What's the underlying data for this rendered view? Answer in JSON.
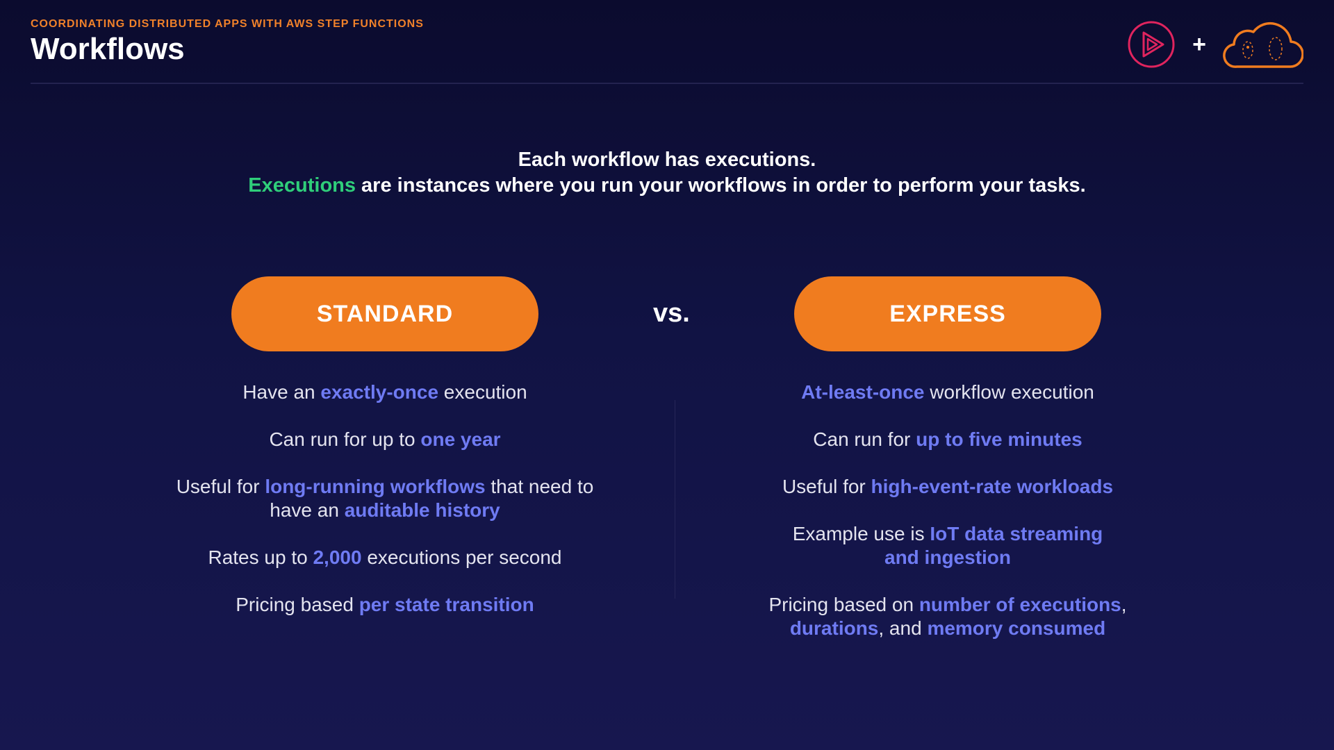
{
  "header": {
    "course": "COORDINATING DISTRIBUTED APPS WITH AWS STEP FUNCTIONS",
    "title": "Workflows",
    "plus": "+"
  },
  "intro": {
    "line1": "Each workflow has executions.",
    "line2_highlight": "Executions",
    "line2_rest": " are instances where you run your workflows in order to perform your tasks."
  },
  "standard": {
    "label": "STANDARD",
    "items": [
      {
        "a": "Have an ",
        "b": "exactly-once",
        "c": " execution"
      },
      {
        "a": "Can run for up to ",
        "b": "one year"
      },
      {
        "a": "Useful for ",
        "b": "long-running workflows",
        "c": " that need to have an ",
        "d": "auditable history"
      },
      {
        "a": "Rates up to ",
        "b": "2,000",
        "c": " executions per second"
      },
      {
        "a": "Pricing based ",
        "b": "per state transition"
      }
    ]
  },
  "vs": "vs.",
  "express": {
    "label": "EXPRESS",
    "items": [
      {
        "b": "At-least-once",
        "c": " workflow execution"
      },
      {
        "a": "Can run for ",
        "b": "up to five minutes"
      },
      {
        "a": "Useful for ",
        "b": "high-event-rate workloads"
      },
      {
        "a": "Example use is ",
        "b": "IoT data streaming and ingestion"
      },
      {
        "a": "Pricing based on ",
        "b": "number of executions",
        "c": ", ",
        "d": "durations",
        "e": ", and ",
        "f": "memory consumed"
      }
    ]
  },
  "icons": [
    "pluralsight-play-icon",
    "aws-cloud-icon"
  ],
  "colors": {
    "accent_orange": "#f07c1f",
    "highlight_blue": "#6f7bf3",
    "highlight_green": "#2fce7a",
    "logo_pink": "#e0245e"
  }
}
